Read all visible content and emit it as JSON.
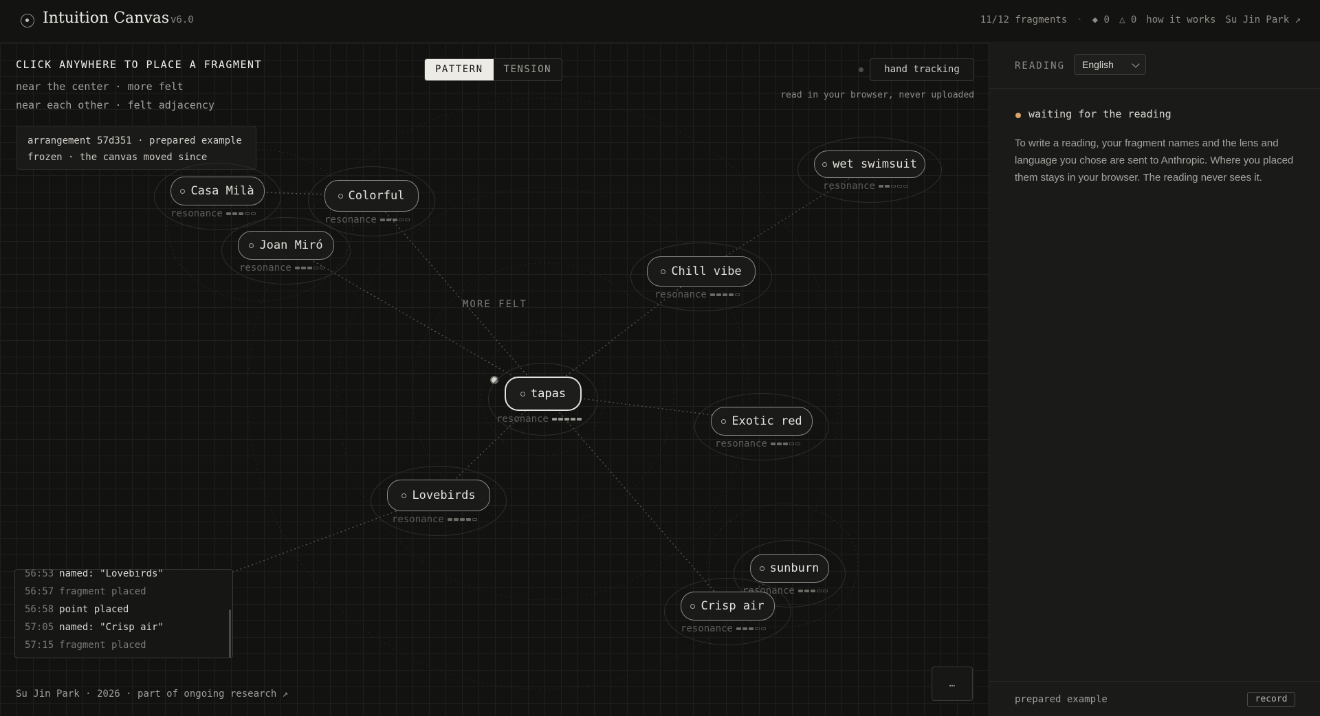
{
  "header": {
    "title": "Intuition Canvas",
    "version": "v6.0",
    "fragments_count": "11/12 fragments",
    "diamond_count": "◆ 0",
    "triangle_count": "△ 0",
    "how_it_works": "how it works",
    "author_link": "Su Jin Park ↗"
  },
  "canvas": {
    "instruction": "CLICK ANYWHERE TO PLACE A FRAGMENT",
    "hint1": "near the center · more felt",
    "hint2": "near each other · felt adjacency",
    "arrangement_line1": "arrangement 57d351 · prepared example",
    "arrangement_line2": "frozen · the canvas moved since",
    "modes": [
      "PATTERN",
      "TENSION"
    ],
    "active_mode": "PATTERN",
    "hand_tracking": "hand tracking",
    "local_note": "read in your browser, never uploaded",
    "more_felt": "MORE FELT",
    "resonance_label": "resonance",
    "fragments": [
      {
        "name": "Casa Milà",
        "resonance": 3
      },
      {
        "name": "Colorful",
        "resonance": 3
      },
      {
        "name": "Joan Miró",
        "resonance": 3
      },
      {
        "name": "wet swimsuit",
        "resonance": 2
      },
      {
        "name": "Chill vibe",
        "resonance": 4
      },
      {
        "name": "tapas",
        "resonance": 5
      },
      {
        "name": "Exotic red",
        "resonance": 3
      },
      {
        "name": "Lovebirds",
        "resonance": 4
      },
      {
        "name": "sunburn",
        "resonance": 3
      },
      {
        "name": "Crisp air",
        "resonance": 3
      }
    ]
  },
  "log": [
    {
      "time": "56:53",
      "text": "named: \"Lovebirds\"",
      "strong": true
    },
    {
      "time": "56:57",
      "text": "fragment placed",
      "strong": false
    },
    {
      "time": "56:58",
      "text": "point placed",
      "strong": true
    },
    {
      "time": "57:05",
      "text": "named: \"Crisp air\"",
      "strong": true
    },
    {
      "time": "57:15",
      "text": "fragment placed",
      "strong": false
    }
  ],
  "footer": {
    "credit": "Su Jin Park · 2026 · part of ongoing research ↗",
    "more_button": "…"
  },
  "panel": {
    "reading_label": "READING",
    "language": "English",
    "status": "waiting for the reading",
    "status_color": "#d9a46a",
    "body": "To write a reading, your fragment names and the lens and language you chose are sent to Anthropic. Where you placed them stays in your browser. The reading never sees it.",
    "prepared_label": "prepared example",
    "record_button": "record"
  },
  "icons": [
    "logo-icon",
    "chevron-down-icon",
    "fragment-dot-icon",
    "placed-point-icon"
  ]
}
